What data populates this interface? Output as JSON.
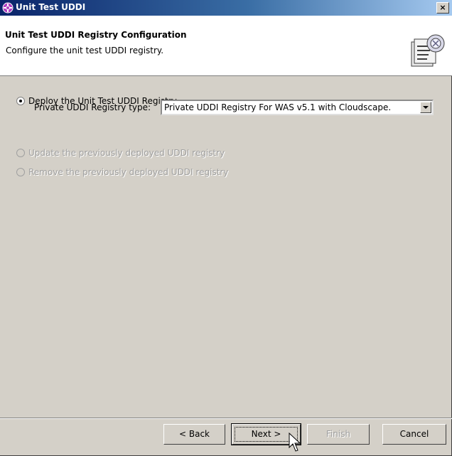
{
  "window": {
    "title": "Unit Test UDDI",
    "close_label": "×"
  },
  "header": {
    "title": "Unit Test UDDI Registry Configuration",
    "description": "Configure the unit test UDDI registry."
  },
  "options": {
    "deploy_label": "Deploy the Unit Test UDDI Registry",
    "registry_type_label": "Private UDDI Registry type:",
    "registry_type_value": "Private UDDI Registry For WAS v5.1 with Cloudscape.",
    "update_label": "Update the previously deployed UDDI registry",
    "remove_label": "Remove the previously deployed UDDI registry",
    "selected": "deploy"
  },
  "buttons": {
    "back": "< Back",
    "next": "Next >",
    "finish": "Finish",
    "cancel": "Cancel"
  }
}
